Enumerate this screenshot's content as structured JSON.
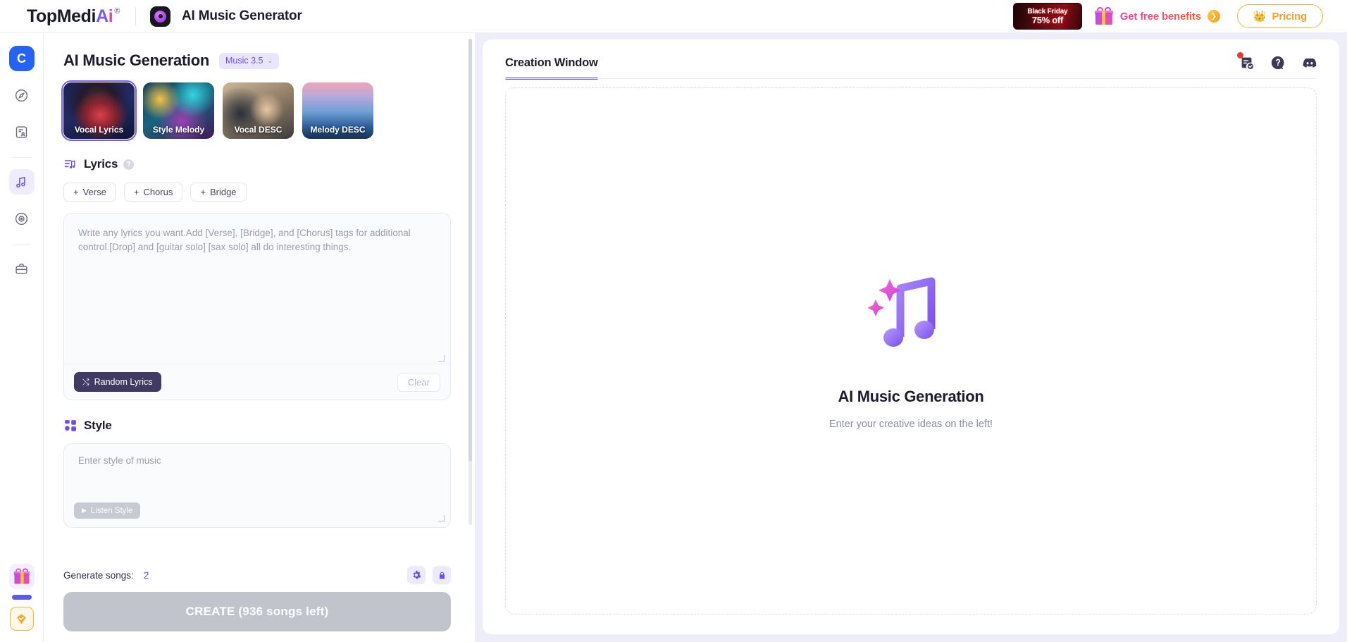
{
  "topbar": {
    "brand_top": "TopMedi",
    "brand_a": "A",
    "brand_i": "i",
    "brand_reg": "®",
    "app_title": "AI Music Generator",
    "promo": {
      "line1": "Black Friday",
      "line2": "75% off"
    },
    "free_benefits": "Get free benefits",
    "free_benefits_arrow": "❯",
    "pricing": "Pricing",
    "crown_icon": "crown-icon"
  },
  "rail": {
    "logo_letter": "C",
    "items": [
      {
        "name": "sidebar-item-home",
        "icon": "compass-icon"
      },
      {
        "name": "sidebar-item-documents",
        "icon": "document-person-icon"
      },
      {
        "name": "sidebar-item-music",
        "icon": "music-note-icon",
        "active": true
      },
      {
        "name": "sidebar-item-record",
        "icon": "disc-icon"
      },
      {
        "name": "sidebar-item-toolbox",
        "icon": "briefcase-icon"
      }
    ],
    "gift_icon": "gift-icon",
    "diamond_icon": "diamond-check-icon"
  },
  "left": {
    "title": "AI Music Generation",
    "model": "Music 3.5",
    "model_chevron": "⌄",
    "cards": [
      {
        "label": "Vocal Lyrics",
        "selected": true
      },
      {
        "label": "Style Melody",
        "selected": false
      },
      {
        "label": "Vocal DESC",
        "selected": false
      },
      {
        "label": "Melody DESC",
        "selected": false
      }
    ],
    "lyrics": {
      "section_icon": "lyrics-icon",
      "section_title": "Lyrics",
      "help_icon": "?",
      "tags": [
        "Verse",
        "Chorus",
        "Bridge"
      ],
      "tag_plus": "+",
      "placeholder": "Write any lyrics you want.Add [Verse], [Bridge], and [Chorus] tags for additional control.[Drop] and [guitar solo] [sax solo] all do interesting things.",
      "value": "",
      "random_button": "Random Lyrics",
      "random_icon": "shuffle-icon",
      "clear_button": "Clear"
    },
    "style": {
      "section_icon": "style-grid-icon",
      "section_title": "Style",
      "placeholder": "Enter style of music",
      "value": "",
      "listen_button": "Listen Style",
      "listen_icon": "play-icon"
    },
    "footer": {
      "generate_label": "Generate songs:",
      "generate_value": "2",
      "settings_icon": "gear-icon",
      "lock_icon": "lock-icon",
      "create_button": "CREATE (936 songs left)"
    }
  },
  "right": {
    "tab_label": "Creation Window",
    "icons": [
      {
        "name": "tasks-icon",
        "badge": true
      },
      {
        "name": "help-circle-icon",
        "badge": false
      },
      {
        "name": "discord-icon",
        "badge": false
      }
    ],
    "empty": {
      "art_icon": "music-note-sparkle-icon",
      "title": "AI Music Generation",
      "subtitle": "Enter your creative ideas on the left!"
    }
  },
  "colors": {
    "accent": "#6c4df4",
    "brand_blue": "#2563f6",
    "gold": "#f0a32a",
    "panel_bg": "#eeeefb",
    "badge_red": "#f5332f"
  }
}
